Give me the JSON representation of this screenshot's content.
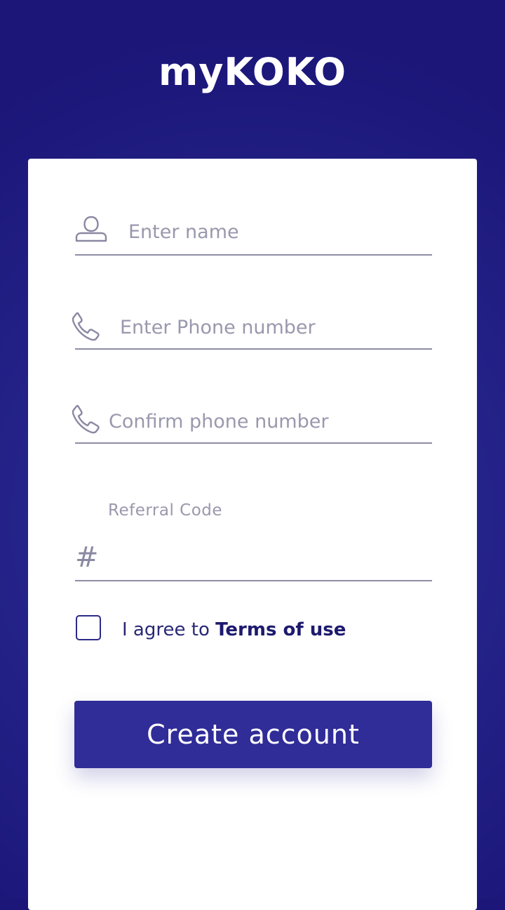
{
  "app": {
    "title": "myKOKO"
  },
  "form": {
    "name_placeholder": "Enter name",
    "phone_placeholder": "Enter Phone number",
    "confirm_phone_placeholder": "Confirm phone number",
    "referral_label": "Referral Code",
    "referral_icon": "#",
    "terms_prefix": "I agree to",
    "terms_link": "Terms of use",
    "terms_checked": false,
    "submit_label": "Create account"
  },
  "icons": {
    "name": "user-icon",
    "phone": "phone-icon",
    "confirm_phone": "phone-icon",
    "referral": "hash-icon"
  },
  "colors": {
    "background": "#1b1678",
    "primary": "#302c98",
    "text_dark": "#1d1a6e",
    "placeholder": "#9a98ad",
    "underline": "#8e8da6"
  }
}
